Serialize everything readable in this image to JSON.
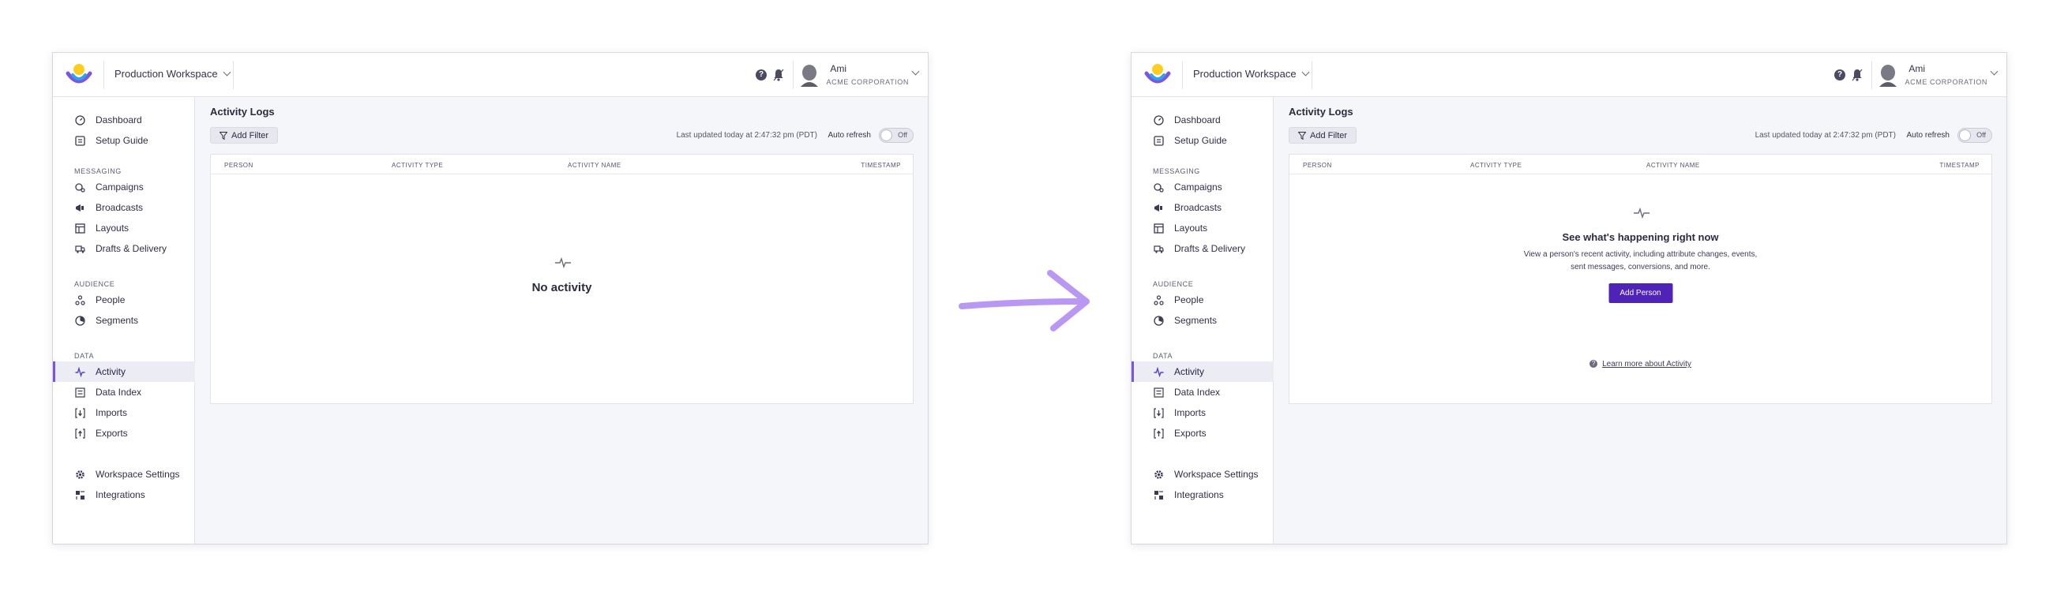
{
  "colors": {
    "accent": "#7b55e0",
    "primary_button": "#4f22b8",
    "arrow": "#b898f2"
  },
  "topbar": {
    "workspace": "Production Workspace",
    "help_icon": "help-icon",
    "bell_icon": "bell-icon",
    "user_name": "Ami",
    "user_org": "ACME CORPORATION"
  },
  "sidebar": {
    "dashboard": "Dashboard",
    "setup_guide": "Setup Guide",
    "messaging_section": "MESSAGING",
    "campaigns": "Campaigns",
    "broadcasts": "Broadcasts",
    "layouts": "Layouts",
    "drafts": "Drafts & Delivery",
    "audience_section": "AUDIENCE",
    "people": "People",
    "segments": "Segments",
    "data_section": "DATA",
    "activity": "Activity",
    "data_index": "Data Index",
    "imports": "Imports",
    "exports": "Exports",
    "workspace_settings": "Workspace Settings",
    "integrations": "Integrations"
  },
  "main": {
    "title": "Activity Logs",
    "add_filter": "Add Filter",
    "last_updated": "Last updated today at 2:47:32 pm (PDT)",
    "auto_refresh": "Auto refresh",
    "toggle_state": "Off",
    "columns": {
      "person": "PERSON",
      "activity_type": "ACTIVITY TYPE",
      "activity_name": "ACTIVITY NAME",
      "timestamp": "TIMESTAMP"
    }
  },
  "before": {
    "empty_title": "No activity"
  },
  "after": {
    "empty_title": "See what's happening right now",
    "empty_desc_line1": "View a person's recent activity, including attribute changes, events,",
    "empty_desc_line2": "sent messages, conversions, and more.",
    "add_person": "Add Person",
    "learn_more": "Learn more about Activity"
  }
}
